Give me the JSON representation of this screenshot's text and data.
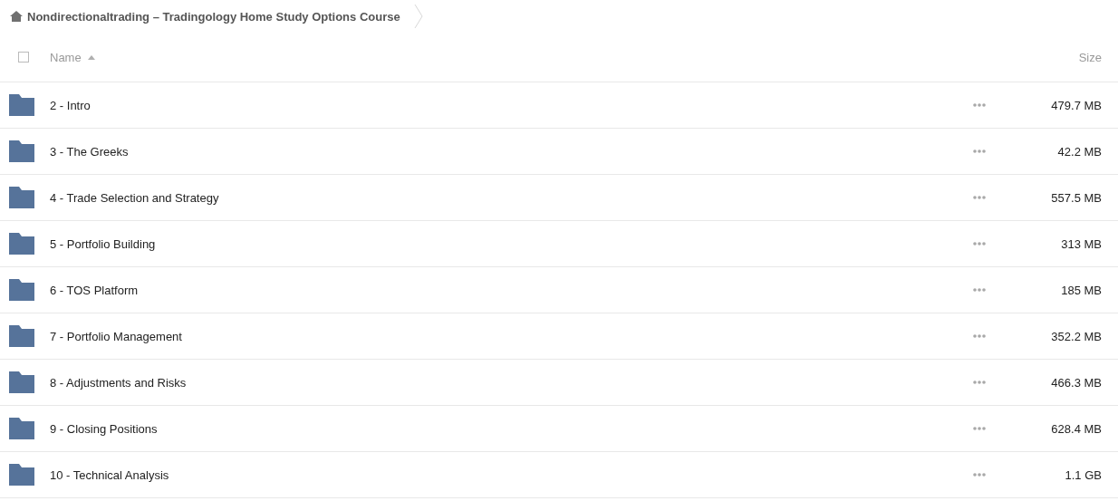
{
  "breadcrumb": {
    "title": "Nondirectionaltrading – Tradingology Home Study Options Course"
  },
  "table": {
    "select_all": {
      "checked": false
    },
    "columns": [
      {
        "label": "Name",
        "sorted": true
      },
      {
        "label": "Size"
      }
    ],
    "rows": [
      {
        "name": "2 - Intro",
        "size": "479.7 MB"
      },
      {
        "name": "3 - The Greeks",
        "size": "42.2 MB"
      },
      {
        "name": "4 - Trade Selection and Strategy",
        "size": "557.5 MB"
      },
      {
        "name": "5 - Portfolio Building",
        "size": "313 MB"
      },
      {
        "name": "6 - TOS Platform",
        "size": "185 MB"
      },
      {
        "name": "7 - Portfolio Management",
        "size": "352.2 MB"
      },
      {
        "name": "8 - Adjustments and Risks",
        "size": "466.3 MB"
      },
      {
        "name": "9 - Closing Positions",
        "size": "628.4 MB"
      },
      {
        "name": "10 - Technical Analysis",
        "size": "1.1 GB"
      }
    ]
  }
}
